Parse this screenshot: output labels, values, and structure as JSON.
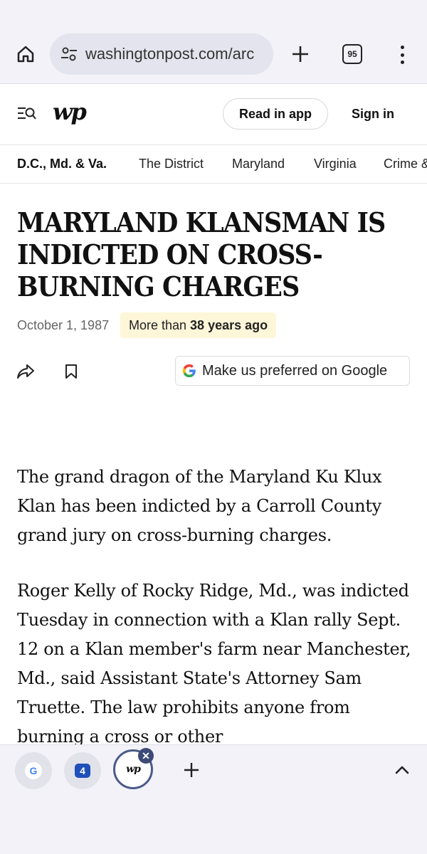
{
  "browser": {
    "url": "washingtonpost.com/arc",
    "tab_count": "95",
    "icons": [
      "home-icon",
      "page-info-icon",
      "plus-icon",
      "tab-switcher-icon",
      "more-vert-icon"
    ]
  },
  "header": {
    "logo": "wp",
    "read_in_app": "Read in app",
    "sign_in": "Sign in"
  },
  "section_nav": {
    "items": [
      {
        "label": "D.C., Md. & Va.",
        "active": true
      },
      {
        "label": "The District"
      },
      {
        "label": "Maryland"
      },
      {
        "label": "Virginia"
      },
      {
        "label": "Crime &"
      }
    ]
  },
  "article": {
    "headline": "MARYLAND KLANSMAN IS INDICTED ON CROSS-BURNING CHARGES",
    "headline_lines": [
      "MARYLAND KLANSMAN IS",
      "INDICTED ON CROSS-",
      "BURNING CHARGES"
    ],
    "date": "October 1, 1987",
    "age_prefix": "More than",
    "age_value": "38 years ago",
    "google_pref": "Make us preferred on Google",
    "paragraphs": [
      "The grand dragon of the Maryland Ku Klux Klan has been indicted by a Carroll County grand jury on cross-burning charges.",
      "Roger Kelly of Rocky Ridge, Md., was indicted Tuesday in connection with a Klan rally Sept. 12 on a Klan member's farm near Manchester, Md., said Assistant State's Attorney Sam Truette. The law prohibits anyone from burning a cross or other"
    ]
  },
  "tab_strip": {
    "tabs": [
      {
        "label": "G",
        "name": "google"
      },
      {
        "label": "4",
        "name": "nbc4"
      },
      {
        "label": "wp",
        "name": "washington-post",
        "active": true
      }
    ],
    "colors": {
      "active_ring": "#4a5a8a",
      "close_bg": "#3c4a78"
    }
  }
}
